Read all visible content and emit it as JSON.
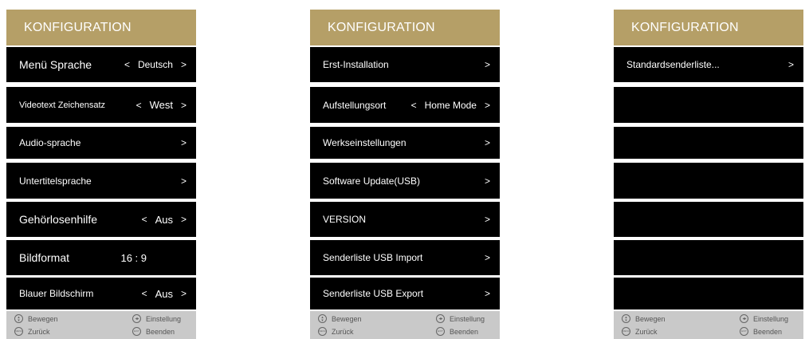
{
  "panels": [
    {
      "title": "KONFIGURATION",
      "rows": [
        {
          "label": "Menü Sprache",
          "left": "<",
          "value": "Deutsch",
          "right": ">"
        },
        {
          "label": "Videotext Zeichensatz",
          "left": "<",
          "value": "West",
          "right": ">"
        },
        {
          "label": "Audio-sprache",
          "left": "",
          "value": "",
          "right": ">"
        },
        {
          "label": "Untertitelsprache",
          "left": "",
          "value": "",
          "right": ">"
        },
        {
          "label": "Gehörlosenhilfe",
          "left": "<",
          "value": "Aus",
          "right": ">"
        },
        {
          "label": "Bildformat",
          "left": "",
          "value": "16 : 9",
          "right": ""
        },
        {
          "label": "Blauer Bildschirm",
          "left": "<",
          "value": "Aus",
          "right": ">"
        }
      ],
      "footer": {
        "move": "Bewegen",
        "setting": "Einstellung",
        "back": "Zurück",
        "exit": "Beenden",
        "menu_icon": "MENU",
        "exit_icon": "EXIT"
      }
    },
    {
      "title": "KONFIGURATION",
      "rows": [
        {
          "label": "Erst-Installation",
          "left": "",
          "value": "",
          "right": ">"
        },
        {
          "label": "Aufstellungsort",
          "left": "<",
          "value": "Home Mode",
          "right": ">"
        },
        {
          "label": "Werkseinstellungen",
          "left": "",
          "value": "",
          "right": ">"
        },
        {
          "label": "Software Update(USB)",
          "left": "",
          "value": "",
          "right": ">"
        },
        {
          "label": "VERSION",
          "left": "",
          "value": "",
          "right": ">"
        },
        {
          "label": "Senderliste USB Import",
          "left": "",
          "value": "",
          "right": ">"
        },
        {
          "label": "Senderliste USB Export",
          "left": "",
          "value": "",
          "right": ">"
        }
      ],
      "footer": {
        "move": "Bewegen",
        "setting": "Einstellung",
        "back": "Zurück",
        "exit": "Beenden",
        "menu_icon": "MENU",
        "exit_icon": "EXIT"
      }
    },
    {
      "title": "KONFIGURATION",
      "rows": [
        {
          "label": "Standardsenderliste...",
          "left": "",
          "value": "",
          "right": ">"
        },
        {
          "label": "",
          "left": "",
          "value": "",
          "right": ""
        },
        {
          "label": "",
          "left": "",
          "value": "",
          "right": ""
        },
        {
          "label": "",
          "left": "",
          "value": "",
          "right": ""
        },
        {
          "label": "",
          "left": "",
          "value": "",
          "right": ""
        },
        {
          "label": "",
          "left": "",
          "value": "",
          "right": ""
        },
        {
          "label": "",
          "left": "",
          "value": "",
          "right": ""
        }
      ],
      "footer": {
        "move": "Bewegen",
        "setting": "Einstellung",
        "back": "Zurück",
        "exit": "Beenden",
        "menu_icon": "MENU",
        "exit_icon": "EXIT"
      }
    }
  ],
  "icons": {
    "move": "up-down-icon",
    "setting": "left-right-icon",
    "back": "menu-icon",
    "exit": "exit-icon"
  },
  "colors": {
    "header": "#b59f67",
    "row": "#000000",
    "footer": "#c9c9c9",
    "text": "#ffffff"
  }
}
